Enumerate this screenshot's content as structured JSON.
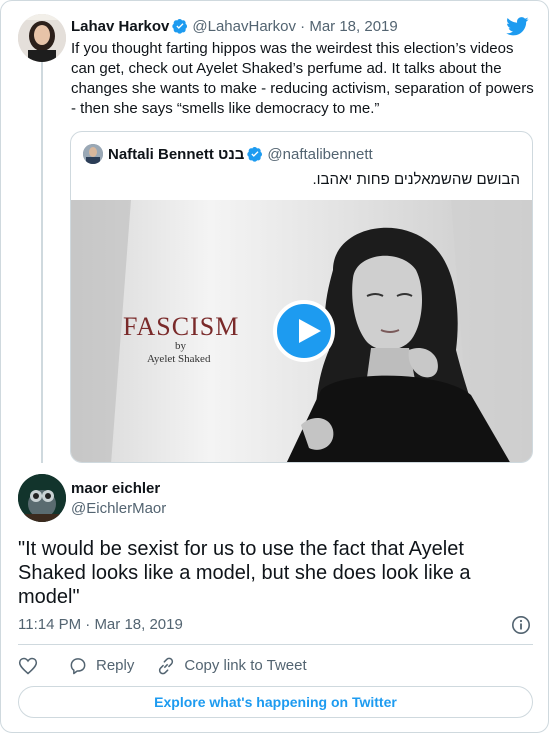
{
  "colors": {
    "accent": "#1d9bf0",
    "muted": "#536471",
    "border": "#cfd9de",
    "text": "#0f1419"
  },
  "tweet": {
    "author_name": "Lahav Harkov",
    "author_handle": "@LahavHarkov",
    "separator": "·",
    "date": "Mar 18, 2019",
    "text": "If you thought farting hippos was the weirdest this election’s videos can get, check out Ayelet Shaked’s perfume ad. It talks about the changes she wants to make - reducing activism, separation of powers - then she says “smells like democracy to me.”",
    "verified_icon": "verified-badge-icon",
    "brand_icon": "twitter-bird-icon"
  },
  "quoted": {
    "author_name": "Naftali Bennett בנט",
    "author_handle": "@naftalibennett",
    "text": "הבושם שהשמאלנים פחות יאהבו.",
    "video": {
      "title_word": "FASCISM",
      "by": "by",
      "by_name": "Ayelet Shaked",
      "play_icon": "play-icon"
    }
  },
  "reply": {
    "author_name": "maor eichler",
    "author_handle": "@EichlerMaor",
    "text": "\"It would be sexist for us to use the fact that Ayelet Shaked looks like a model, but she does look like a model\"",
    "time": "11:14 PM",
    "separator": "·",
    "date": "Mar 18, 2019",
    "info_icon": "info-icon"
  },
  "actions": {
    "like_icon": "heart-icon",
    "reply_label": "Reply",
    "copy_label": "Copy link to Tweet"
  },
  "explore_label": "Explore what's happening on Twitter"
}
